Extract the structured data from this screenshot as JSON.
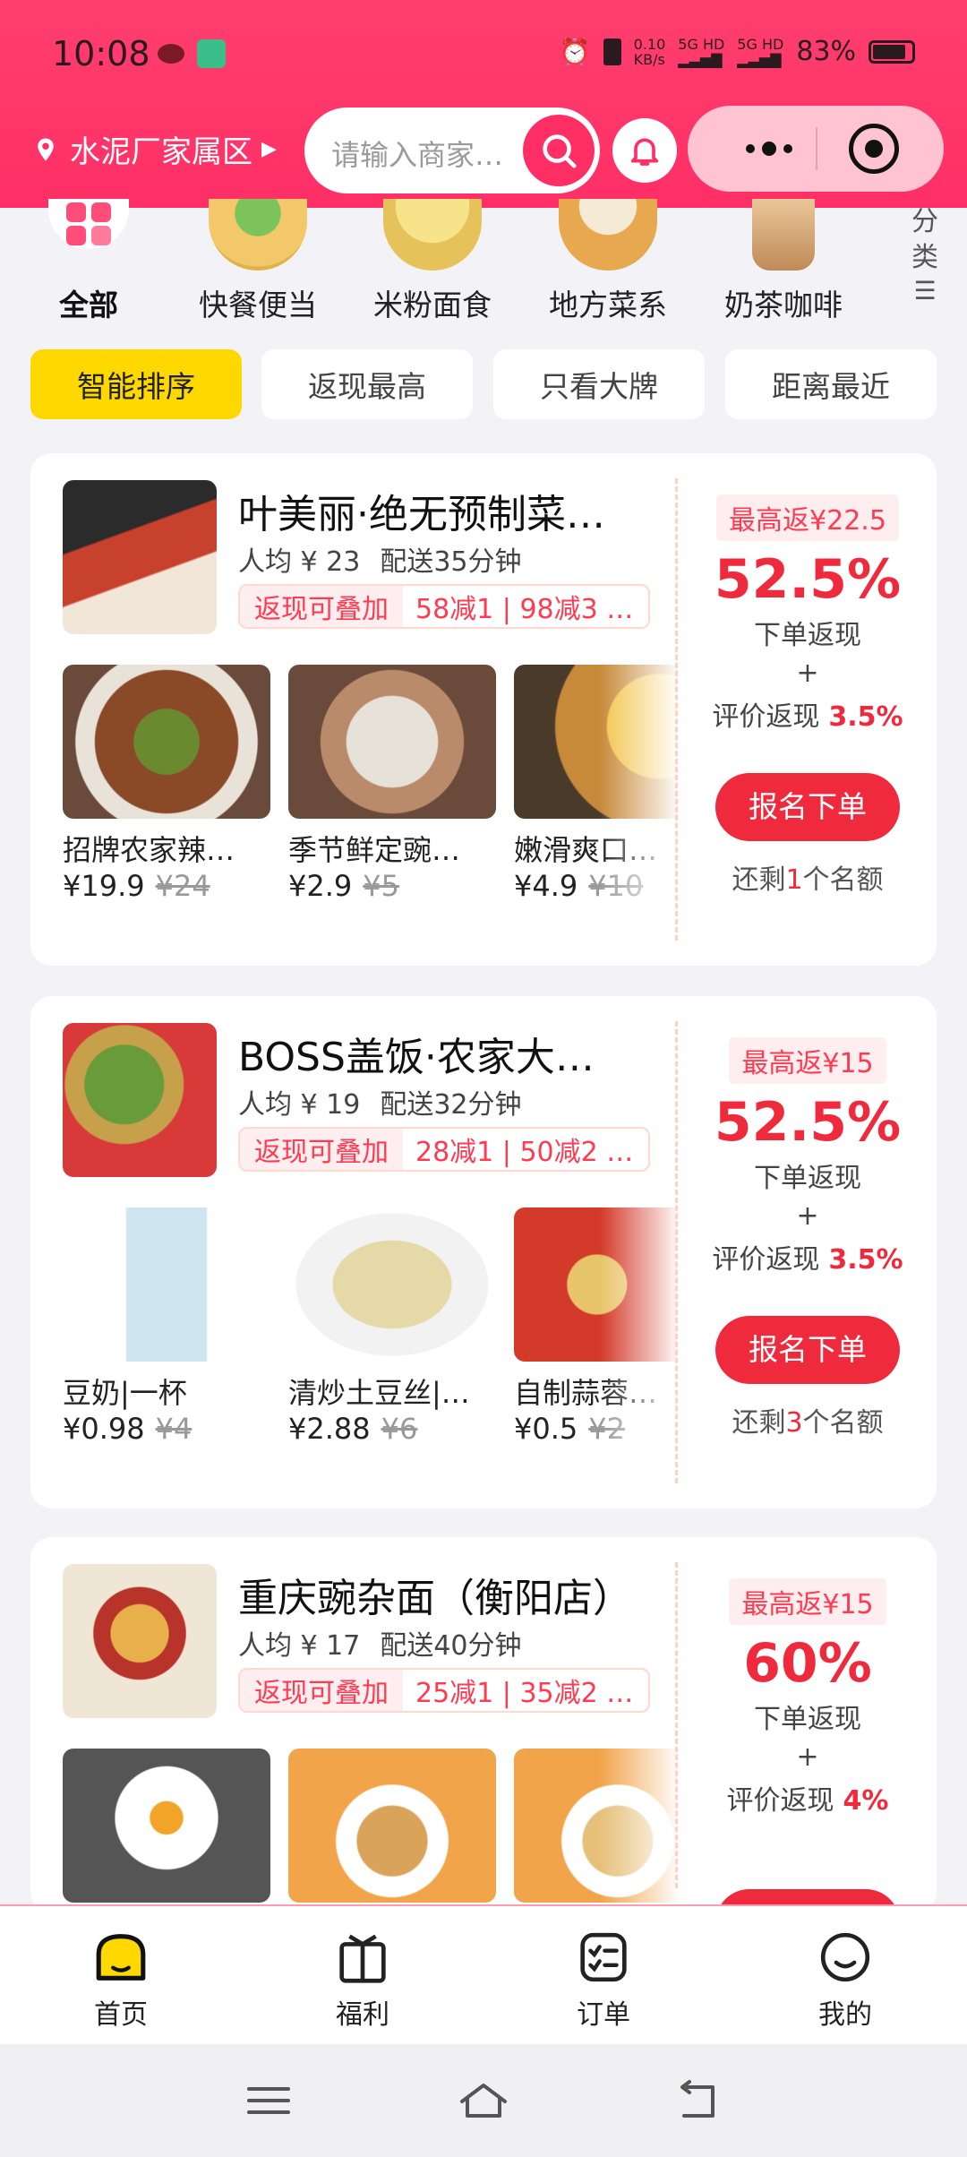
{
  "status_bar": {
    "time": "10:08",
    "network_speed_value": "0.10",
    "network_speed_unit": "KB/s",
    "sim1": "5G HD",
    "sim2": "5G HD",
    "battery": "83%"
  },
  "header": {
    "location": "水泥厂家属区",
    "search_placeholder": "请输入商家…"
  },
  "categories": [
    {
      "label": "全部",
      "icon": "all-grid-icon"
    },
    {
      "label": "快餐便当",
      "icon": "bento-icon"
    },
    {
      "label": "米粉面食",
      "icon": "noodle-icon"
    },
    {
      "label": "地方菜系",
      "icon": "steamer-icon"
    },
    {
      "label": "奶茶咖啡",
      "icon": "milk-tea-icon"
    }
  ],
  "category_more": {
    "label_chars": [
      "分",
      "类"
    ],
    "icon": "list-icon"
  },
  "filters": [
    {
      "label": "智能排序"
    },
    {
      "label": "返现最高"
    },
    {
      "label": "只看大牌"
    },
    {
      "label": "距离最近"
    }
  ],
  "shops": [
    {
      "name": "叶美丽·绝无预制菜…",
      "avg_price": "人均 ¥ 23",
      "delivery": "配送35分钟",
      "promo_tag": "返现可叠加",
      "promo_text": "58减1 | 98减3 | …",
      "dishes": [
        {
          "name": "招牌农家辣…",
          "price": "¥19.9",
          "old_price": "¥24"
        },
        {
          "name": "季节鲜定豌…",
          "price": "¥2.9",
          "old_price": "¥5"
        },
        {
          "name": "嫩滑爽口…",
          "price": "¥4.9",
          "old_price": "¥10"
        }
      ],
      "max_return": "最高返¥22.5",
      "rate": "52.5%",
      "rate_label": "下单返现",
      "plus": "+",
      "review_label": "评价返现",
      "review_rate": "3.5%",
      "signup": "报名下单",
      "quota_prefix": "还剩",
      "quota_num": "1",
      "quota_suffix": "个名额"
    },
    {
      "name": "BOSS盖饭·农家大…",
      "avg_price": "人均 ¥ 19",
      "delivery": "配送32分钟",
      "promo_tag": "返现可叠加",
      "promo_text": "28减1 | 50减2 | …",
      "dishes": [
        {
          "name": "豆奶|一杯",
          "price": "¥0.98",
          "old_price": "¥4"
        },
        {
          "name": "清炒土豆丝|…",
          "price": "¥2.88",
          "old_price": "¥6"
        },
        {
          "name": "自制蒜蓉…",
          "price": "¥0.5",
          "old_price": "¥2"
        }
      ],
      "max_return": "最高返¥15",
      "rate": "52.5%",
      "rate_label": "下单返现",
      "plus": "+",
      "review_label": "评价返现",
      "review_rate": "3.5%",
      "signup": "报名下单",
      "quota_prefix": "还剩",
      "quota_num": "3",
      "quota_suffix": "个名额"
    },
    {
      "name": "重庆豌杂面（衡阳店）",
      "avg_price": "人均 ¥ 17",
      "delivery": "配送40分钟",
      "promo_tag": "返现可叠加",
      "promo_text": "25减1 | 35减2 | …",
      "max_return": "最高返¥15",
      "rate": "60%",
      "rate_label": "下单返现",
      "plus": "+",
      "review_label": "评价返现",
      "review_rate": "4%"
    }
  ],
  "tabs": [
    {
      "label": "首页",
      "icon": "home-icon"
    },
    {
      "label": "福利",
      "icon": "gift-icon"
    },
    {
      "label": "订单",
      "icon": "order-list-icon"
    },
    {
      "label": "我的",
      "icon": "profile-icon"
    }
  ],
  "colors": {
    "header_bg": "#ff2f66",
    "accent_red": "#ef2a3d",
    "filter_active": "#ffd800"
  }
}
